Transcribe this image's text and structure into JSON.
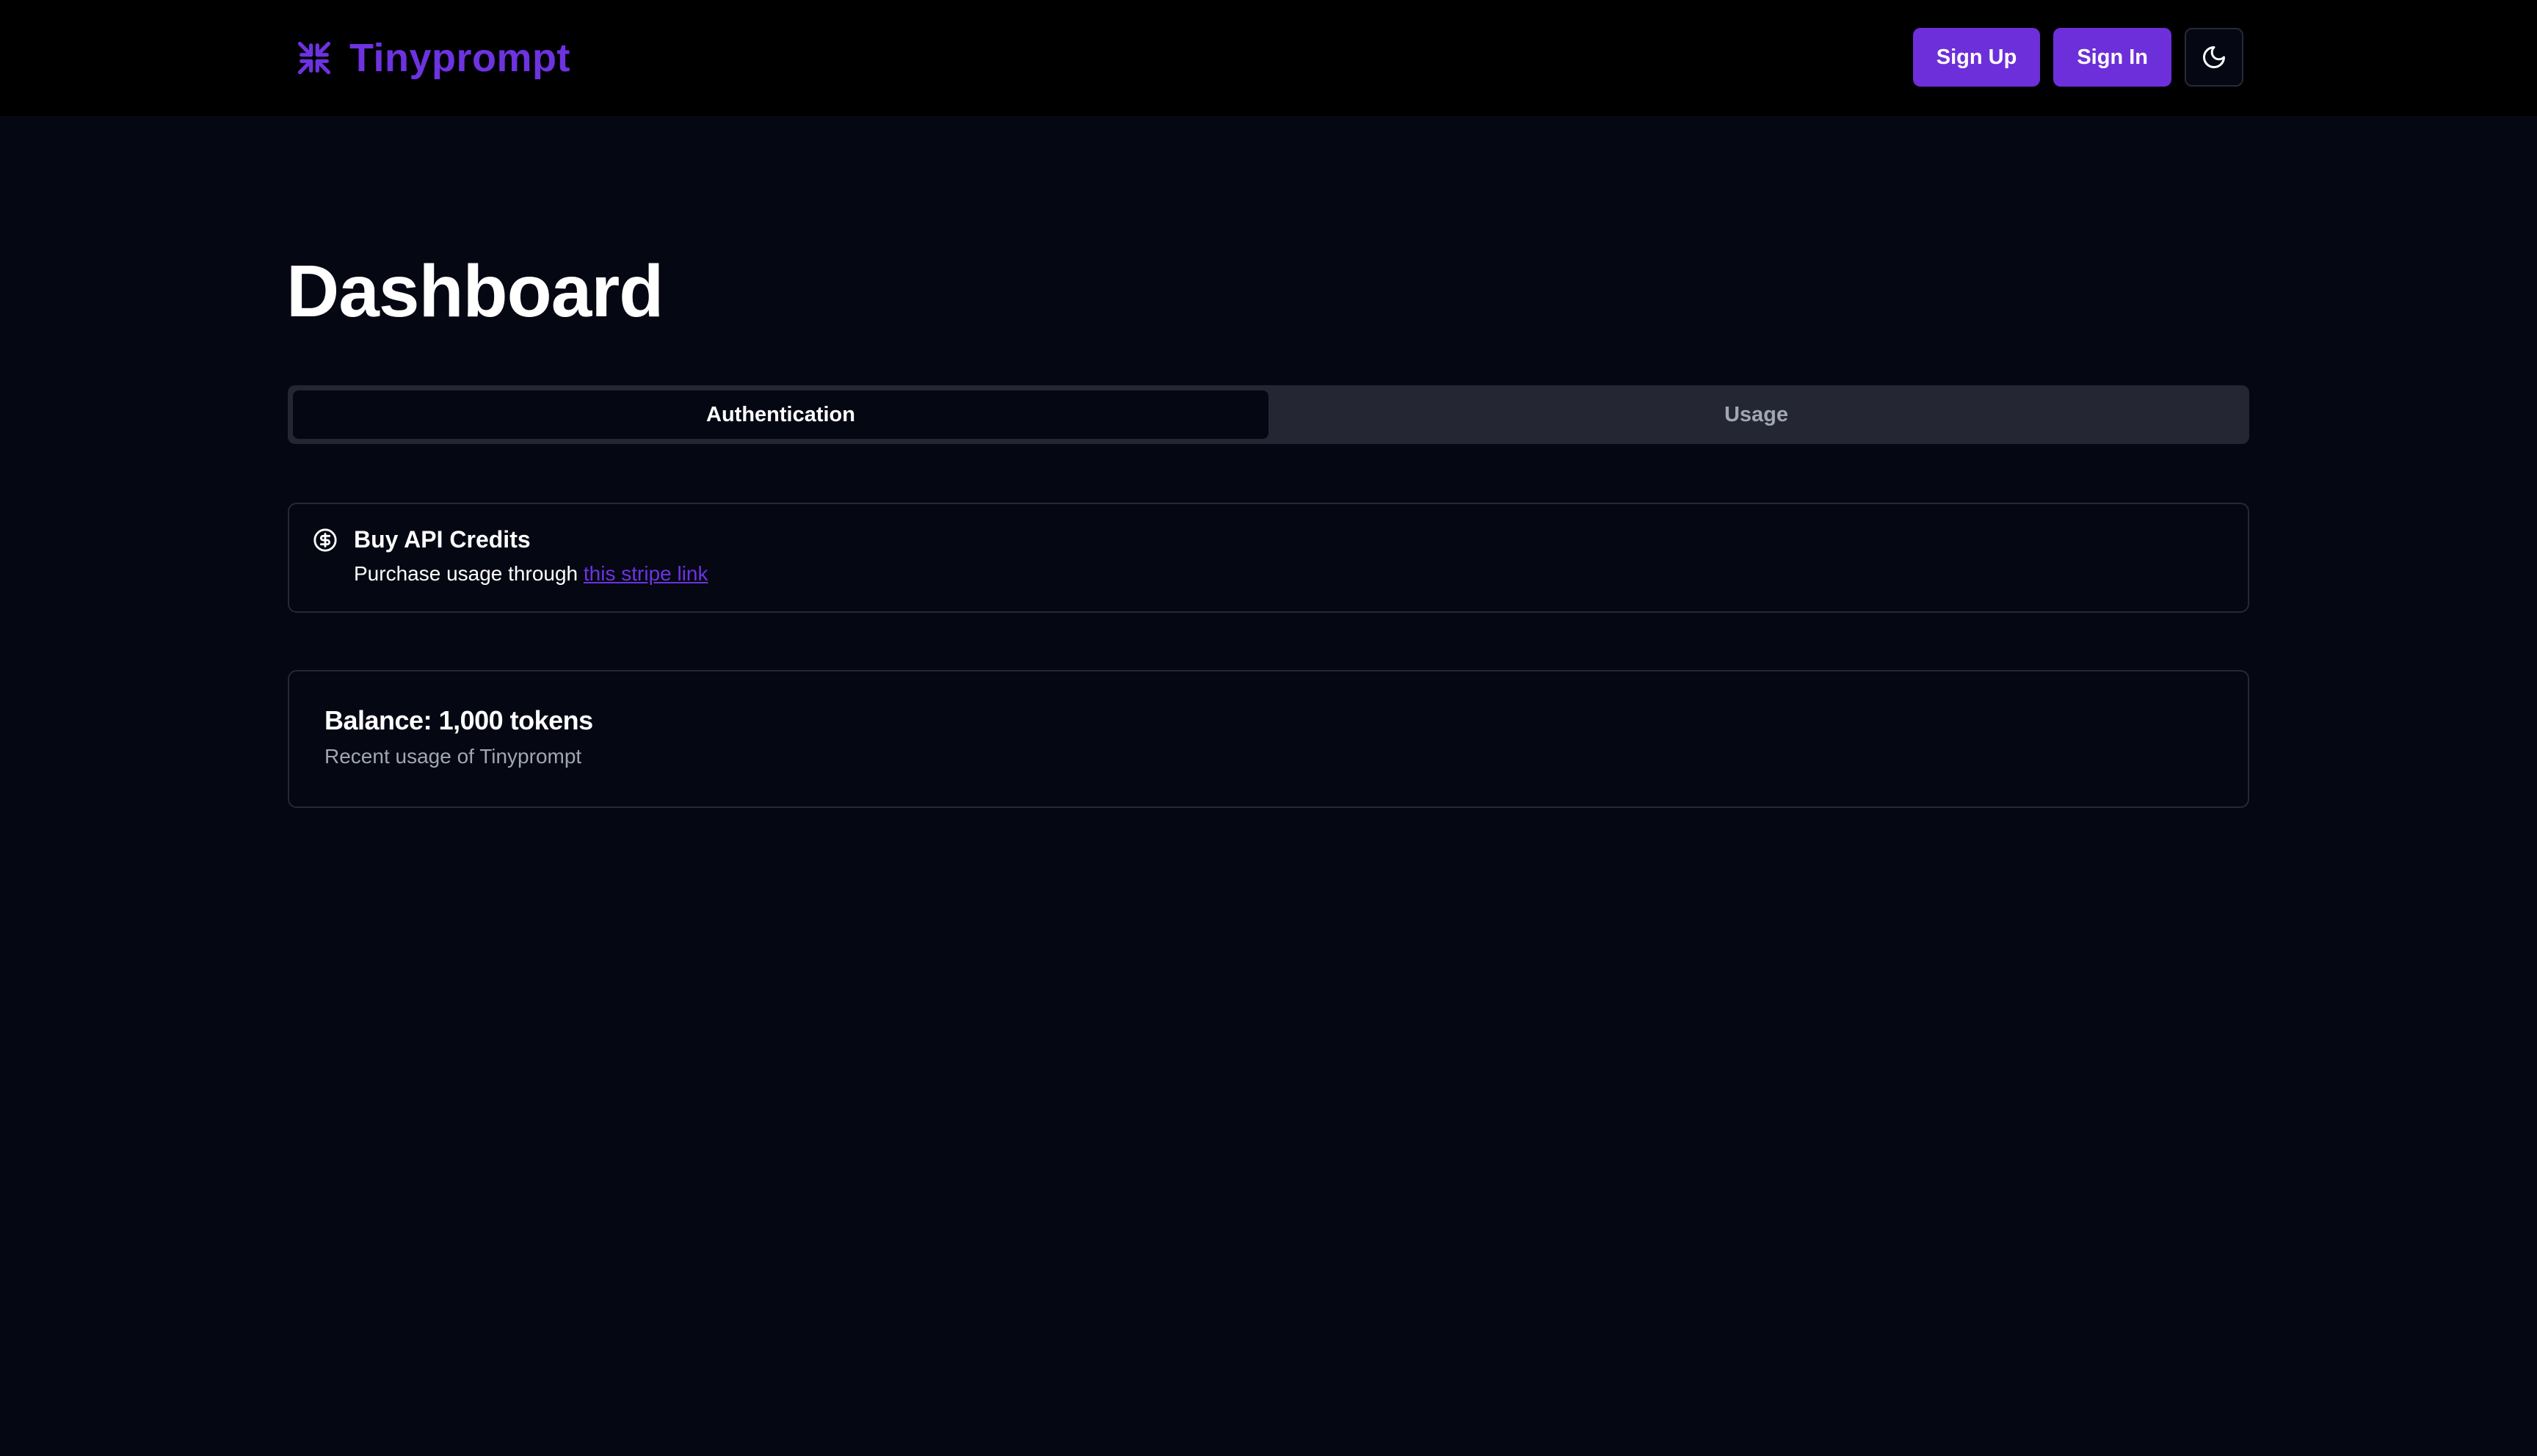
{
  "header": {
    "brand_name": "Tinyprompt",
    "brand_icon": "shrink-arrows-icon",
    "sign_up_label": "Sign Up",
    "sign_in_label": "Sign In",
    "theme_toggle_icon": "moon-icon"
  },
  "main": {
    "title": "Dashboard",
    "tabs": [
      {
        "label": "Authentication",
        "active": true
      },
      {
        "label": "Usage",
        "active": false
      }
    ],
    "credits_card": {
      "icon": "dollar-circle-icon",
      "title": "Buy API Credits",
      "description_prefix": "Purchase usage through ",
      "link_text": "this stripe link"
    },
    "balance_card": {
      "title": "Balance: 1,000 tokens",
      "subtitle": "Recent usage of Tinyprompt"
    }
  },
  "colors": {
    "accent": "#6d2fd9",
    "brand_text": "#6d33e0",
    "page_background": "#050713",
    "header_background": "#000000",
    "tab_bar_background": "#242733",
    "card_border": "#252936"
  }
}
